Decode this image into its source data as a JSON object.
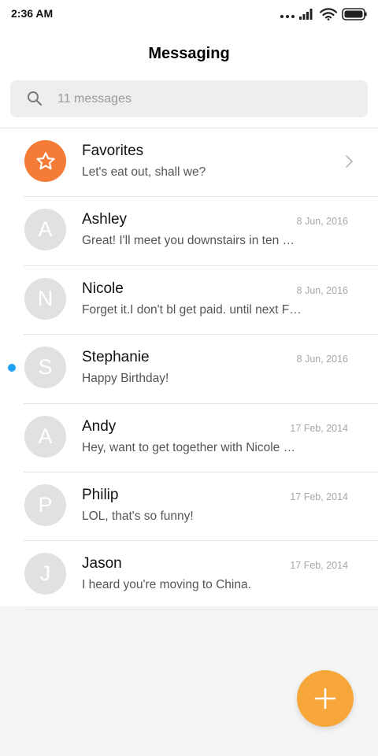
{
  "status_bar": {
    "time": "2:36 AM",
    "icons": [
      "more-dots-icon",
      "signal-icon",
      "wifi-icon",
      "battery-icon"
    ]
  },
  "header": {
    "title": "Messaging"
  },
  "search": {
    "placeholder": "11 messages"
  },
  "favorites": {
    "name": "Favorites",
    "snippet": "Let's eat out, shall we?",
    "icon": "star-icon",
    "color": "#f47c36"
  },
  "conversations": [
    {
      "initial": "A",
      "name": "Ashley",
      "date": "8 Jun, 2016",
      "snippet": "Great! I'll meet you downstairs in ten …",
      "unread": false
    },
    {
      "initial": "N",
      "name": "Nicole",
      "date": "8 Jun, 2016",
      "snippet": "Forget it.I don't bl get paid. until next F…",
      "unread": false
    },
    {
      "initial": "S",
      "name": "Stephanie",
      "date": "8 Jun, 2016",
      "snippet": "Happy Birthday!",
      "unread": true
    },
    {
      "initial": "A",
      "name": "Andy",
      "date": "17 Feb, 2014",
      "snippet": "Hey, want to get together with Nicole …",
      "unread": false
    },
    {
      "initial": "P",
      "name": "Philip",
      "date": "17 Feb, 2014",
      "snippet": "LOL, that's so funny!",
      "unread": false
    },
    {
      "initial": "J",
      "name": "Jason",
      "date": "17 Feb, 2014",
      "snippet": "I heard you're moving to China.",
      "unread": false
    }
  ],
  "fab": {
    "icon": "plus-icon",
    "color": "#f7a63a"
  },
  "colors": {
    "unread_dot": "#1ea1f2",
    "avatar_bg": "#e1e1e1"
  }
}
